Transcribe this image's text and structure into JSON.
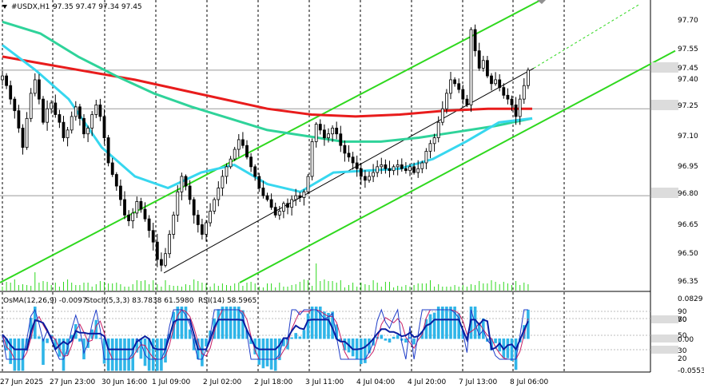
{
  "header": {
    "symbol": "#USDX,H1",
    "ohlc": "97.35 97.47 97.34 97.45",
    "dropdown_icon": "triangle-down-icon"
  },
  "sub_header": {
    "osma": "OsMA(12,26,9) -0.0097",
    "stoch": "Stoch(5,3,3) 83.7838 61.5980",
    "rsi": "RSI(14) 58.5965"
  },
  "colors": {
    "grid": "#000000",
    "candle": "#000000",
    "ema_red": "#e81c1c",
    "ema_green": "#2fd39a",
    "ema_cyan": "#37d7ef",
    "channel": "#2fd81e",
    "osma": "#2fb5e8",
    "stoch_main": "#1e3cc8",
    "stoch_signal": "#c81e64",
    "rsi": "#0a1ea0"
  },
  "price_axis": {
    "ticks": [
      "97.70",
      "97.55",
      "97.40",
      "97.25",
      "97.10",
      "96.95",
      "96.80",
      "96.65",
      "96.50",
      "96.35"
    ],
    "current_price_label": "97.45",
    "level_upper_label": "97.25",
    "level_lower_label": "96.80"
  },
  "indicator_axis": {
    "ticks": [
      "0.0829",
      "90",
      "80",
      "70",
      "50",
      "0.00",
      "30",
      "20",
      "-0.0553"
    ]
  },
  "time_axis": {
    "ticks": [
      "27 Jun 2025",
      "27 Jun 23:00",
      "30 Jun 16:00",
      "1 Jul 09:00",
      "2 Jul 02:00",
      "2 Jul 18:00",
      "3 Jul 11:00",
      "4 Jul 04:00",
      "4 Jul 20:00",
      "7 Jul 13:00",
      "8 Jul 06:00"
    ]
  },
  "chart_data": {
    "type": "candlestick",
    "symbol": "#USDX",
    "timeframe": "H1",
    "ylim": [
      96.3,
      97.8
    ],
    "last_close": 97.45,
    "horizontal_levels": [
      97.45,
      97.25,
      96.8
    ],
    "close_path": [
      97.42,
      97.37,
      97.3,
      97.24,
      97.15,
      97.05,
      97.2,
      97.33,
      97.4,
      97.3,
      97.18,
      97.25,
      97.28,
      97.22,
      97.18,
      97.1,
      97.14,
      97.21,
      97.26,
      97.2,
      97.12,
      97.15,
      97.22,
      97.27,
      97.21,
      97.1,
      96.97,
      96.91,
      96.85,
      96.78,
      96.7,
      96.67,
      96.71,
      96.77,
      96.73,
      96.68,
      96.62,
      96.56,
      96.47,
      96.44,
      96.5,
      96.6,
      96.7,
      96.82,
      96.9,
      96.85,
      96.78,
      96.7,
      96.65,
      96.6,
      96.66,
      96.72,
      96.78,
      96.84,
      96.9,
      96.95,
      96.99,
      97.04,
      97.09,
      97.06,
      97.0,
      96.95,
      96.9,
      96.84,
      96.8,
      96.78,
      96.74,
      96.7,
      96.72,
      96.76,
      96.74,
      96.78,
      96.8,
      96.79,
      96.82,
      96.9,
      97.08,
      97.17,
      97.14,
      97.1,
      97.12,
      97.15,
      97.12,
      97.06,
      97.02,
      97.0,
      96.97,
      96.94,
      96.9,
      96.88,
      96.9,
      96.92,
      96.95,
      96.96,
      96.94,
      96.93,
      96.95,
      96.96,
      96.94,
      96.93,
      96.95,
      96.92,
      96.94,
      96.97,
      97.03,
      97.07,
      97.1,
      97.18,
      97.25,
      97.33,
      97.4,
      97.38,
      97.35,
      97.3,
      97.27,
      97.66,
      97.55,
      97.46,
      97.5,
      97.42,
      97.38,
      97.4,
      97.36,
      97.32,
      97.3,
      97.27,
      97.21,
      97.3,
      97.37,
      97.45
    ],
    "ema_red_path": [
      97.52,
      97.48,
      97.44,
      97.4,
      97.35,
      97.3,
      97.25,
      97.22,
      97.21,
      97.22,
      97.24,
      97.25,
      97.25
    ],
    "ema_green_path": [
      97.7,
      97.64,
      97.52,
      97.42,
      97.33,
      97.26,
      97.2,
      97.14,
      97.11,
      97.08,
      97.08,
      97.1,
      97.13,
      97.16,
      97.2
    ],
    "ema_cyan_path": [
      97.58,
      97.45,
      97.3,
      97.05,
      96.9,
      96.84,
      96.92,
      96.96,
      96.86,
      96.82,
      96.92,
      96.93,
      96.94,
      96.99,
      97.08,
      97.18,
      97.2
    ],
    "channel": {
      "upper_line": [
        [
          0,
          96.35
        ],
        [
          680,
          97.82
        ]
      ],
      "lower_line": [
        [
          300,
          96.35
        ],
        [
          845,
          97.55
        ]
      ],
      "mid_line": [
        [
          205,
          96.4
        ],
        [
          668,
          97.46
        ]
      ]
    }
  }
}
